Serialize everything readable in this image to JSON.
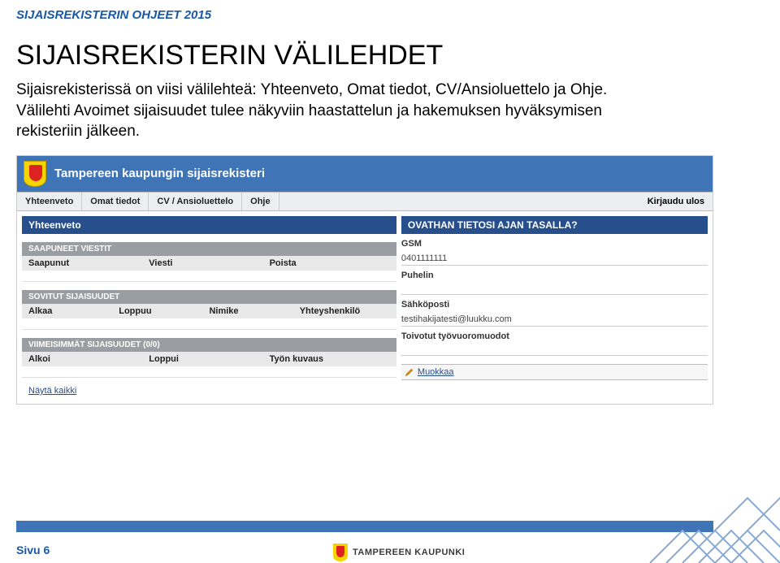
{
  "doc_header": "SIJAISREKISTERIN OHJEET 2015",
  "title": "SIJAISREKISTERIN VÄLILEHDET",
  "paragraph": "Sijaisrekisterissä on viisi välilehteä: Yhteenveto, Omat tiedot, CV/Ansioluettelo ja Ohje. Välilehti Avoimet sijaisuudet tulee näkyviin haastattelun ja hakemuksen hyväksymisen rekisteriin jälkeen.",
  "screenshot": {
    "app_title": "Tampereen kaupungin sijaisrekisteri",
    "tabs": [
      "Yhteenveto",
      "Omat tiedot",
      "CV / Ansioluettelo",
      "Ohje"
    ],
    "logout": "Kirjaudu ulos",
    "left_panel_title": "Yhteenveto",
    "section_messages": {
      "title": "SAAPUNEET VIESTIT",
      "cols": [
        "Saapunut",
        "Viesti",
        "Poista"
      ]
    },
    "section_agreed": {
      "title": "SOVITUT SIJAISUUDET",
      "cols": [
        "Alkaa",
        "Loppuu",
        "Nimike",
        "Yhteyshenkilö"
      ]
    },
    "section_recent": {
      "title": "VIIMEISIMMÄT SIJAISUUDET (0/0)",
      "cols": [
        "Alkoi",
        "Loppui",
        "Työn kuvaus"
      ]
    },
    "show_all": "Näytä kaikki",
    "right_panel_title": "OVATHAN TIETOSI AJAN TASALLA?",
    "right_fields": {
      "gsm_label": "GSM",
      "gsm_value": "0401111111",
      "phone_label": "Puhelin",
      "phone_value": "",
      "email_label": "Sähköposti",
      "email_value": "testihakijatesti@luukku.com",
      "shifts_label": "Toivotut työvuoromuodot",
      "shifts_value": ""
    },
    "edit_link": "Muokkaa"
  },
  "footer": {
    "page": "Sivu 6",
    "brand": "TAMPEREEN KAUPUNKI"
  }
}
